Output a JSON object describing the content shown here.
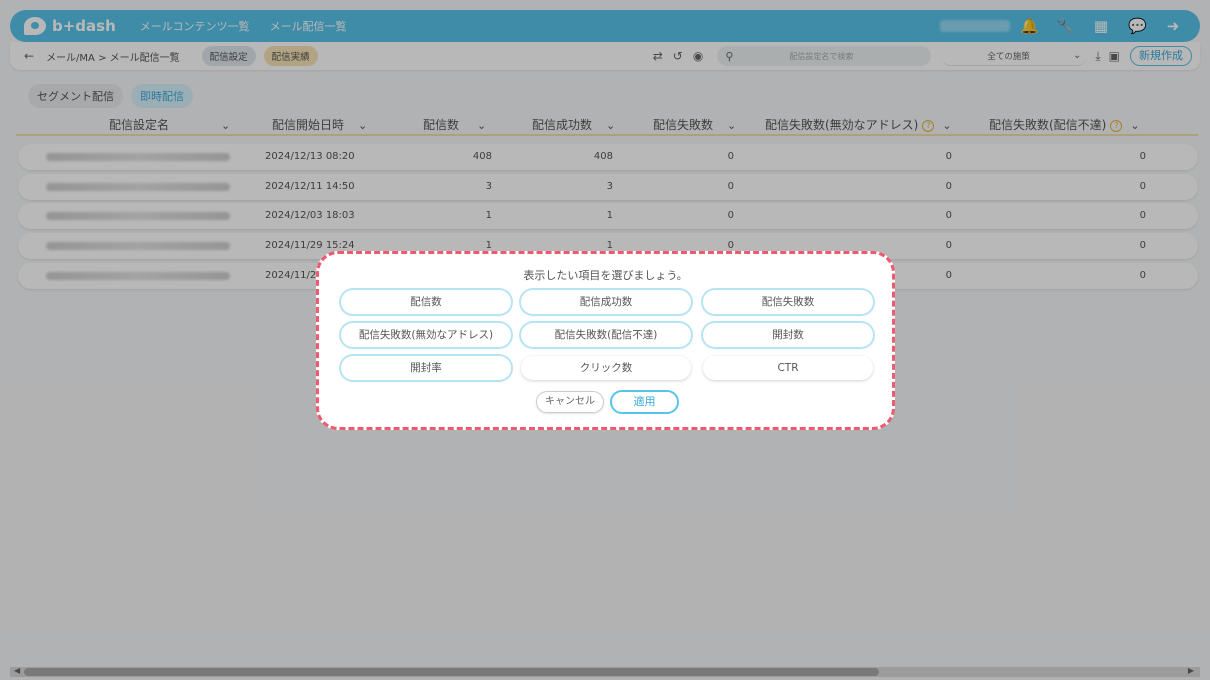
{
  "header": {
    "logo_text": "b+dash",
    "nav": [
      "メールコンテンツ一覧",
      "メール配信一覧"
    ],
    "icons": [
      "bell-icon",
      "wrench-icon",
      "grid-icon",
      "chat-icon",
      "logout-icon"
    ]
  },
  "subbar": {
    "back_icon": "←",
    "breadcrumb": "メール/MA > メール配信一覧",
    "tab_settings": "配信設定",
    "tab_results": "配信実績",
    "search_placeholder": "配信設定名で検索",
    "filter_value": "全ての施策",
    "new_button": "新規作成"
  },
  "segment_tabs": [
    "セグメント配信",
    "即時配信"
  ],
  "table": {
    "headers": [
      "配信設定名",
      "配信開始日時",
      "配信数",
      "配信成功数",
      "配信失敗数",
      "配信失敗数(無効なアドレス)",
      "配信失敗数(配信不達)"
    ],
    "rows": [
      {
        "date": "2024/12/13 08:20",
        "sent": "408",
        "success": "408",
        "fail": "0",
        "fail_invalid": "0",
        "fail_undelivered": "0"
      },
      {
        "date": "2024/12/11 14:50",
        "sent": "3",
        "success": "3",
        "fail": "0",
        "fail_invalid": "0",
        "fail_undelivered": "0"
      },
      {
        "date": "2024/12/03 18:03",
        "sent": "1",
        "success": "1",
        "fail": "0",
        "fail_invalid": "0",
        "fail_undelivered": "0"
      },
      {
        "date": "2024/11/29 15:24",
        "sent": "1",
        "success": "1",
        "fail": "0",
        "fail_invalid": "0",
        "fail_undelivered": "0"
      },
      {
        "date": "2024/11/2",
        "sent": "",
        "success": "",
        "fail": "",
        "fail_invalid": "0",
        "fail_undelivered": "0"
      }
    ]
  },
  "modal": {
    "title": "表示したい項目を選びましょう。",
    "options": [
      {
        "label": "配信数",
        "selected": true
      },
      {
        "label": "配信成功数",
        "selected": true
      },
      {
        "label": "配信失敗数",
        "selected": true
      },
      {
        "label": "配信失敗数(無効なアドレス)",
        "selected": true
      },
      {
        "label": "配信失敗数(配信不達)",
        "selected": true
      },
      {
        "label": "開封数",
        "selected": true
      },
      {
        "label": "開封率",
        "selected": true
      },
      {
        "label": "クリック数",
        "selected": false
      },
      {
        "label": "CTR",
        "selected": false
      }
    ],
    "cancel_label": "キャンセル",
    "apply_label": "適用"
  },
  "colors": {
    "accent": "#58c3ea",
    "modal_border": "#ef5a6e",
    "tab_active_bg": "#f6e4b6"
  }
}
